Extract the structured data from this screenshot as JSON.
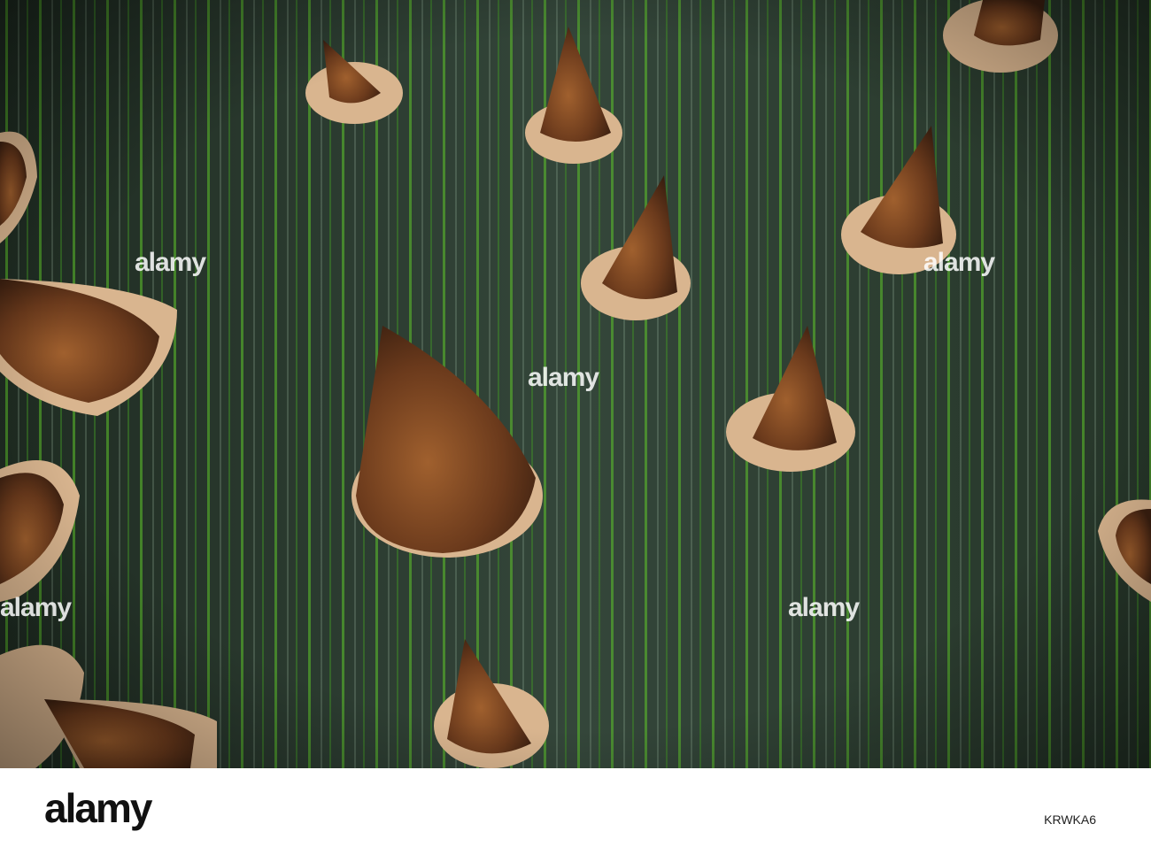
{
  "photo": {
    "subject": "thorny green bark",
    "colors": {
      "bark": "#2c3d30",
      "stripe": "#5fbf2a",
      "thorn": "#6b3a1c",
      "base": "#d9b58f"
    }
  },
  "watermark": {
    "brand": "alamy",
    "tile_id": "a"
  },
  "footer": {
    "logo": "alamy",
    "image_id": "KRWKA6"
  }
}
